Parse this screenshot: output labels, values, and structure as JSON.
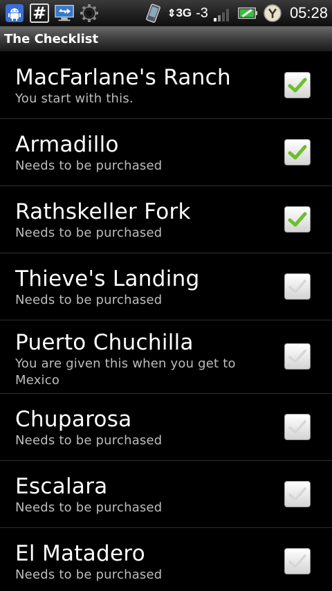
{
  "status_bar": {
    "icons_left": [
      "android-icon",
      "hash-icon",
      "usb-icon",
      "gear-icon"
    ],
    "network": "3G",
    "signal_value": "-3",
    "time": "05:28"
  },
  "title": "The Checklist",
  "colors": {
    "check_on": "#6cbf2a",
    "check_off": "#d6d6d6",
    "background": "#000000"
  },
  "items": [
    {
      "title": "MacFarlane's Ranch",
      "subtitle": "You start with this.",
      "checked": true
    },
    {
      "title": "Armadillo",
      "subtitle": "Needs to be purchased",
      "checked": true
    },
    {
      "title": "Rathskeller Fork",
      "subtitle": "Needs to be purchased",
      "checked": true
    },
    {
      "title": "Thieve's Landing",
      "subtitle": "Needs to be purchased",
      "checked": false
    },
    {
      "title": "Puerto Chuchilla",
      "subtitle": "You are given this when you get to Mexico",
      "checked": false
    },
    {
      "title": "Chuparosa",
      "subtitle": "Needs to be purchased",
      "checked": false
    },
    {
      "title": "Escalara",
      "subtitle": "Needs to be purchased",
      "checked": false
    },
    {
      "title": "El Matadero",
      "subtitle": "Needs to be purchased",
      "checked": false
    }
  ]
}
